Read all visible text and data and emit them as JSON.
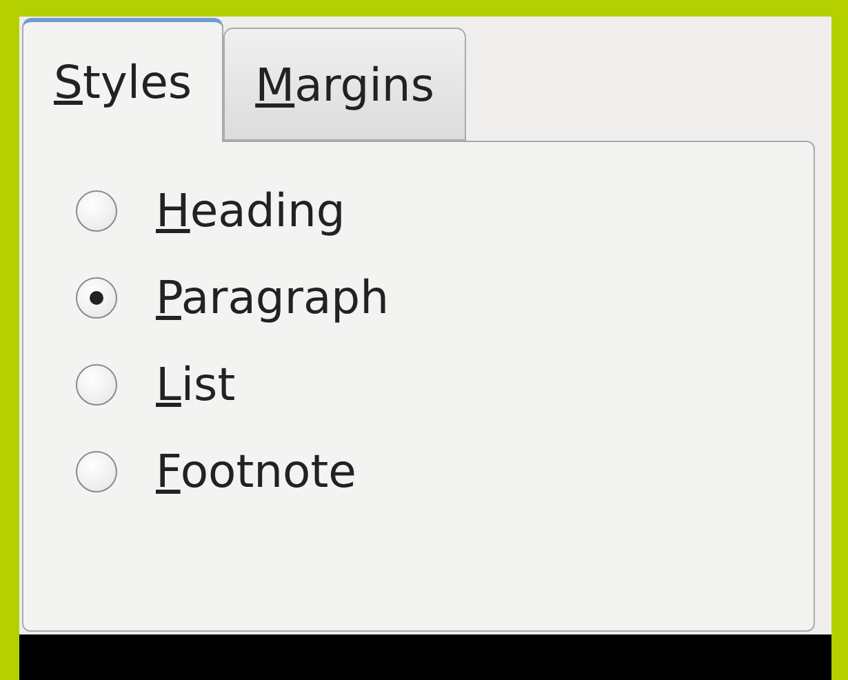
{
  "tabs": [
    {
      "label": "Styles",
      "selected": true
    },
    {
      "label": "Margins",
      "selected": false
    }
  ],
  "options": [
    {
      "label": "Heading",
      "selected": false
    },
    {
      "label": "Paragraph",
      "selected": true
    },
    {
      "label": "List",
      "selected": false
    },
    {
      "label": "Footnote",
      "selected": false
    }
  ]
}
